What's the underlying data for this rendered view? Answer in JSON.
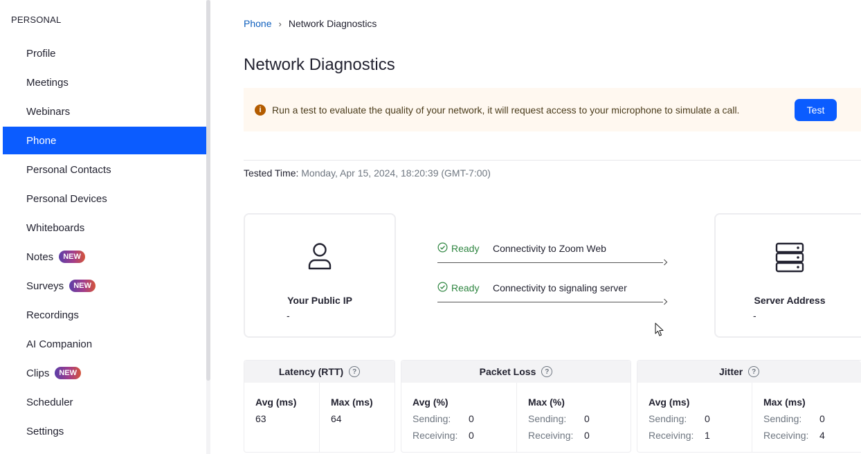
{
  "sidebar": {
    "section": "PERSONAL",
    "items": [
      {
        "label": "Profile",
        "badge": ""
      },
      {
        "label": "Meetings",
        "badge": ""
      },
      {
        "label": "Webinars",
        "badge": ""
      },
      {
        "label": "Phone",
        "badge": "",
        "active": true
      },
      {
        "label": "Personal Contacts",
        "badge": ""
      },
      {
        "label": "Personal Devices",
        "badge": ""
      },
      {
        "label": "Whiteboards",
        "badge": ""
      },
      {
        "label": "Notes",
        "badge": "NEW"
      },
      {
        "label": "Surveys",
        "badge": "NEW"
      },
      {
        "label": "Recordings",
        "badge": ""
      },
      {
        "label": "AI Companion",
        "badge": ""
      },
      {
        "label": "Clips",
        "badge": "NEW"
      },
      {
        "label": "Scheduler",
        "badge": ""
      },
      {
        "label": "Settings",
        "badge": ""
      }
    ]
  },
  "breadcrumb": {
    "parent": "Phone",
    "separator": "›",
    "current": "Network Diagnostics"
  },
  "page": {
    "title": "Network Diagnostics"
  },
  "banner": {
    "icon": "info-icon",
    "text": "Run a test to evaluate the quality of your network, it will request access to your microphone to simulate a call.",
    "button": "Test"
  },
  "tested": {
    "label": "Tested Time:",
    "value": "Monday, Apr 15, 2024, 18:20:39 (GMT-7:00)"
  },
  "cards": {
    "ip": {
      "icon": "user-icon",
      "title": "Your Public IP",
      "value": "-"
    },
    "server": {
      "icon": "server-icon",
      "title": "Server Address",
      "value": "-"
    }
  },
  "connectivity": [
    {
      "status": "Ready",
      "label": "Connectivity to Zoom Web"
    },
    {
      "status": "Ready",
      "label": "Connectivity to signaling server"
    }
  ],
  "metrics": {
    "latency": {
      "title": "Latency (RTT)",
      "avg_label": "Avg (ms)",
      "avg": "63",
      "max_label": "Max (ms)",
      "max": "64"
    },
    "packet_loss": {
      "title": "Packet Loss",
      "avg_label": "Avg (%)",
      "avg_sending": "0",
      "avg_receiving": "0",
      "max_label": "Max (%)",
      "max_sending": "0",
      "max_receiving": "0"
    },
    "jitter": {
      "title": "Jitter",
      "avg_label": "Avg (ms)",
      "avg_sending": "0",
      "avg_receiving": "1",
      "max_label": "Max (ms)",
      "max_sending": "0",
      "max_receiving": "4"
    },
    "sending_label": "Sending:",
    "receiving_label": "Receiving:"
  },
  "colors": {
    "accent": "#0b5cff",
    "ready": "#2e8540",
    "link": "#0e5fbe",
    "banner_bg": "#fff8f0"
  }
}
